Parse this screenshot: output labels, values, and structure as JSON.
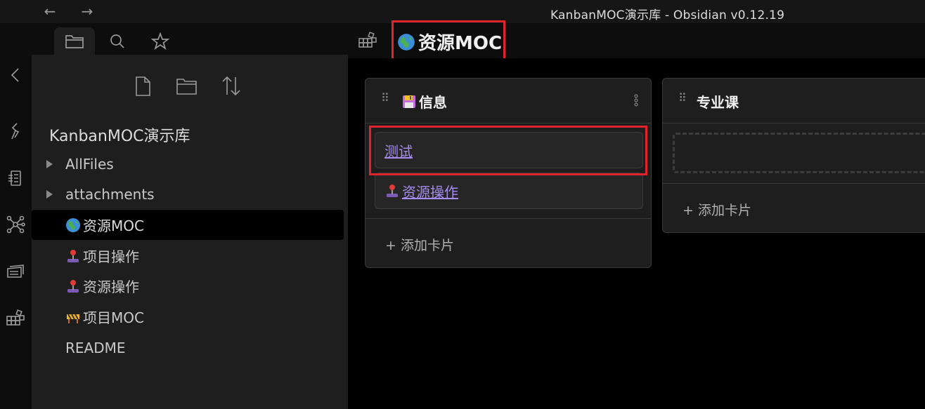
{
  "window": {
    "title": "KanbanMOC演示库 - Obsidian v0.12.19",
    "back_glyph": "←",
    "forward_glyph": "→"
  },
  "ribbon": {
    "icons": [
      "collapse-sidebar-icon",
      "open-quick-switcher-icon",
      "templates-icon",
      "graph-view-icon",
      "slides-icon",
      "kanban-board-icon"
    ]
  },
  "sidebar": {
    "tabs": [
      "file-explorer-icon",
      "search-icon",
      "star-icon"
    ],
    "actions": [
      "new-note-icon",
      "new-folder-icon",
      "sort-order-icon"
    ],
    "vault_name": "KanbanMOC演示库",
    "items": [
      {
        "label": "AllFiles",
        "type": "folder",
        "icon": "caret-right-icon"
      },
      {
        "label": "attachments",
        "type": "folder",
        "icon": "caret-right-icon"
      },
      {
        "label": "资源MOC",
        "type": "file",
        "icon": "globe-emoji-icon",
        "active": true
      },
      {
        "label": "项目操作",
        "type": "file",
        "icon": "joystick-emoji-icon"
      },
      {
        "label": "资源操作",
        "type": "file",
        "icon": "joystick-emoji-icon"
      },
      {
        "label": "项目MOC",
        "type": "file",
        "icon": "construction-emoji-icon"
      },
      {
        "label": "README",
        "type": "file"
      }
    ]
  },
  "main": {
    "view_icon": "kanban-board-icon",
    "note_title": "资源MOC",
    "note_title_icon": "globe-emoji-icon",
    "lanes": [
      {
        "title": "信息",
        "title_icon": "floppy-disk-emoji-icon",
        "cards": [
          {
            "text": "测试"
          },
          {
            "text": "资源操作",
            "icon": "joystick-emoji-icon"
          }
        ],
        "add_card_label": "+ 添加卡片"
      },
      {
        "title": "专业课",
        "cards": [],
        "add_card_label": "+ 添加卡片"
      }
    ]
  },
  "colors": {
    "highlight": "#e0232e",
    "link": "#a48cf0",
    "background": "#000000",
    "panel": "#1e1e1e"
  }
}
